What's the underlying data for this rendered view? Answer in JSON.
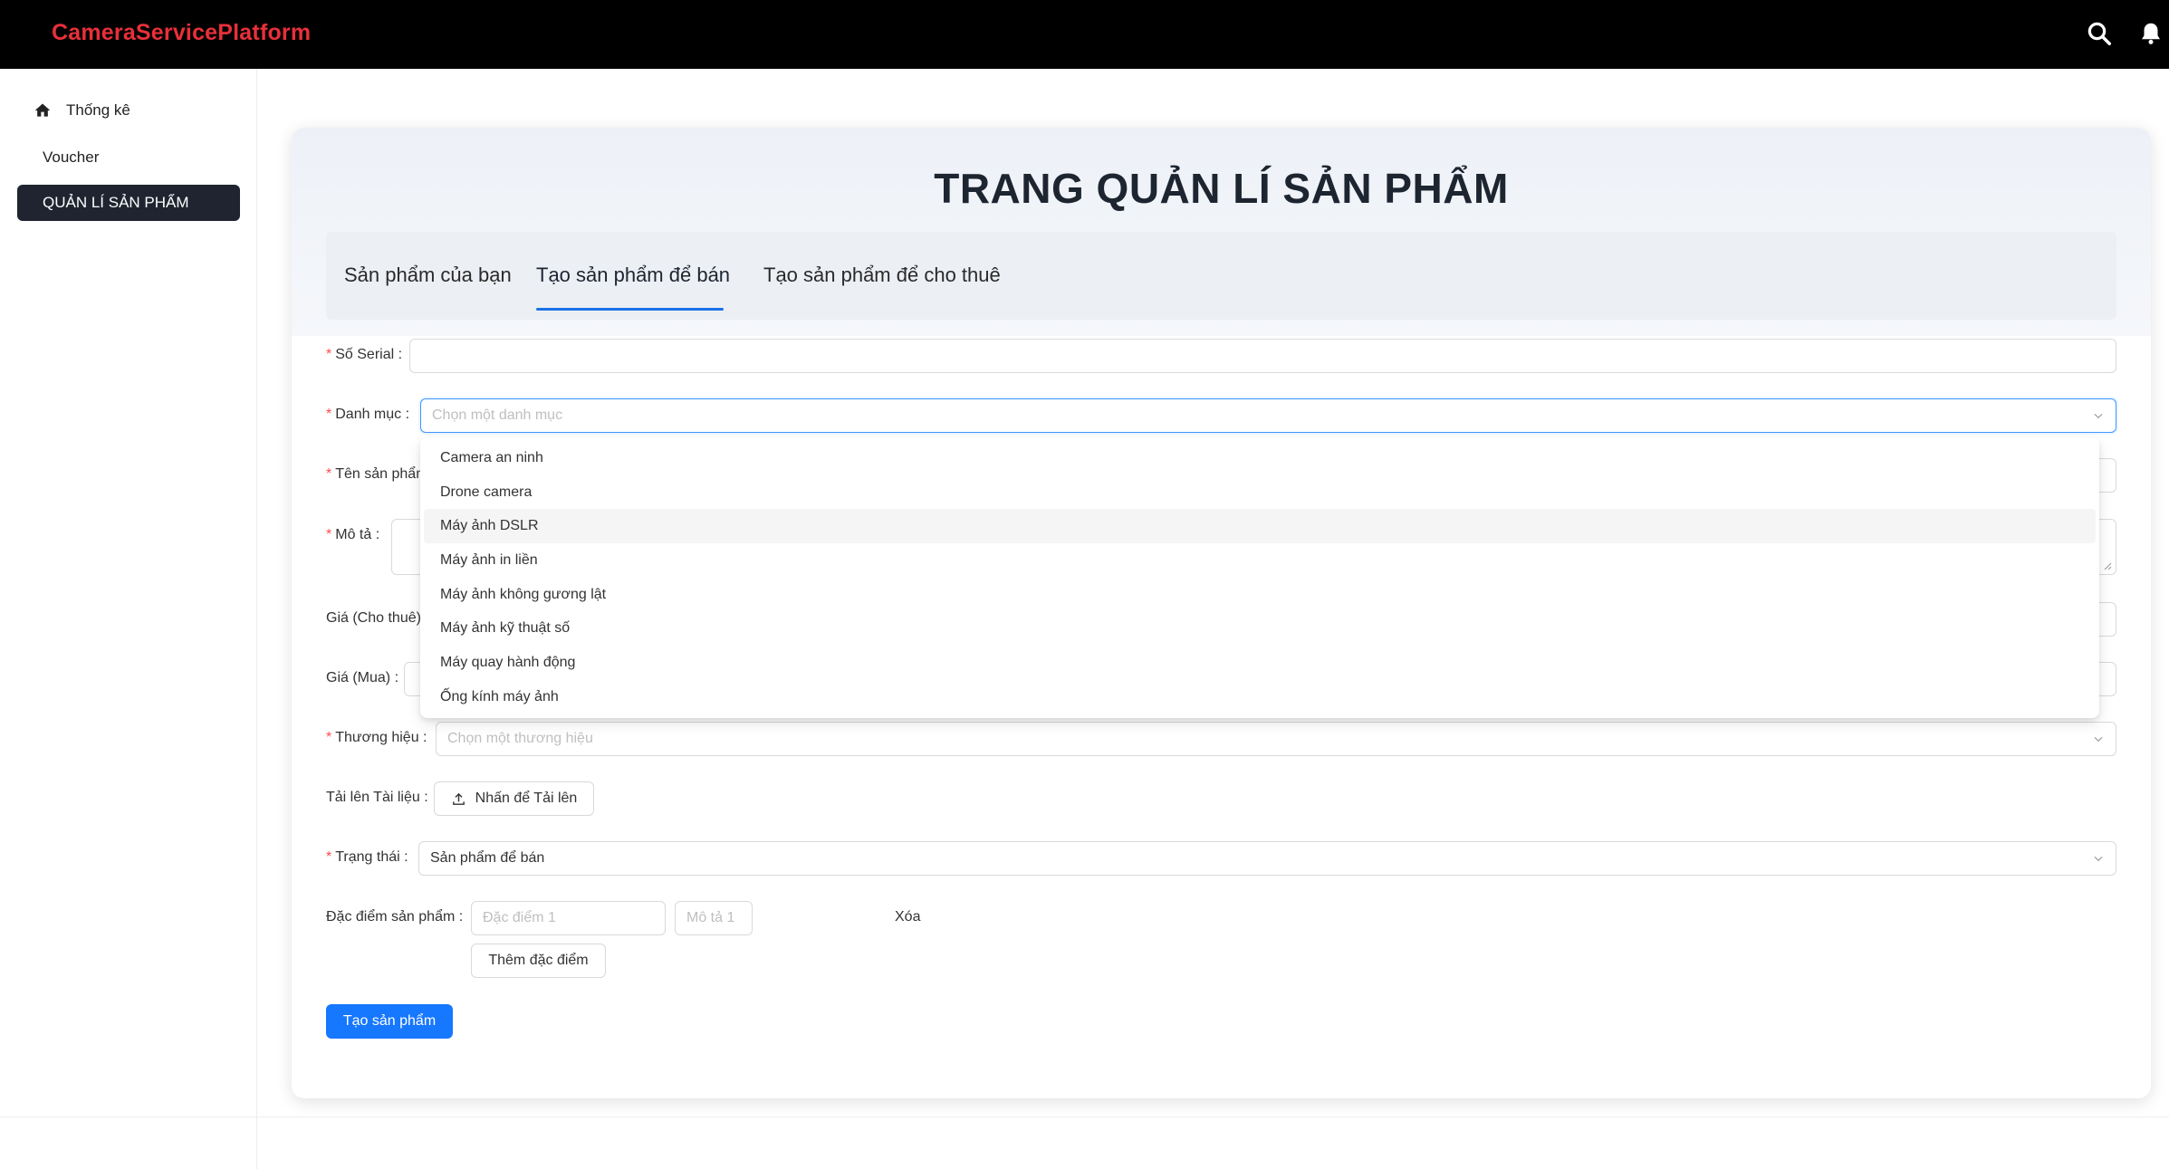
{
  "app": {
    "brand": "CameraServicePlatform"
  },
  "header": {
    "icons": [
      "search-icon",
      "bell-icon"
    ]
  },
  "sidebar": {
    "items": [
      {
        "label": "Thống kê",
        "icon": "home-icon"
      },
      {
        "label": "Voucher"
      },
      {
        "label": "QUẢN LÍ SẢN PHẨM",
        "active": true
      }
    ]
  },
  "page": {
    "title": "TRANG QUẢN LÍ SẢN PHẨM"
  },
  "tabs": [
    {
      "label": "Sản phẩm của bạn"
    },
    {
      "label": "Tạo sản phẩm để bán",
      "active": true
    },
    {
      "label": "Tạo sản phẩm để cho thuê"
    }
  ],
  "form": {
    "serial": {
      "label": "Số Serial",
      "value": ""
    },
    "category": {
      "label": "Danh mục",
      "placeholder": "Chọn một danh mục"
    },
    "name": {
      "label": "Tên sản phẩm"
    },
    "description": {
      "label": "Mô tả"
    },
    "price_rent": {
      "label": "Giá (Cho thuê)"
    },
    "price_buy": {
      "label": "Giá (Mua)"
    },
    "brand": {
      "label": "Thương hiệu",
      "placeholder": "Chọn một thương hiệu"
    },
    "upload": {
      "label": "Tải lên Tài liệu",
      "button": "Nhấn để Tải lên"
    },
    "status": {
      "label": "Trạng thái",
      "value": "Sản phẩm để bán"
    },
    "features": {
      "label": "Đặc điểm sản phẩm",
      "feature_placeholder": "Đặc điểm 1",
      "desc_placeholder": "Mô tả 1",
      "delete": "Xóa",
      "add": "Thêm đặc điểm"
    },
    "submit": "Tạo sản phẩm"
  },
  "category_dropdown": {
    "options": [
      "Camera an ninh",
      "Drone camera",
      "Máy ảnh DSLR",
      "Máy ảnh in liền",
      "Máy ảnh không gương lật",
      "Máy ảnh kỹ thuật số",
      "Máy quay hành động",
      "Ống kính máy ảnh"
    ],
    "hovered": "Máy ảnh DSLR"
  },
  "colors": {
    "brand": "#e8303a",
    "primary": "#1677ff",
    "required": "#ff4d4f",
    "sidebar_active": "#1f2430"
  }
}
